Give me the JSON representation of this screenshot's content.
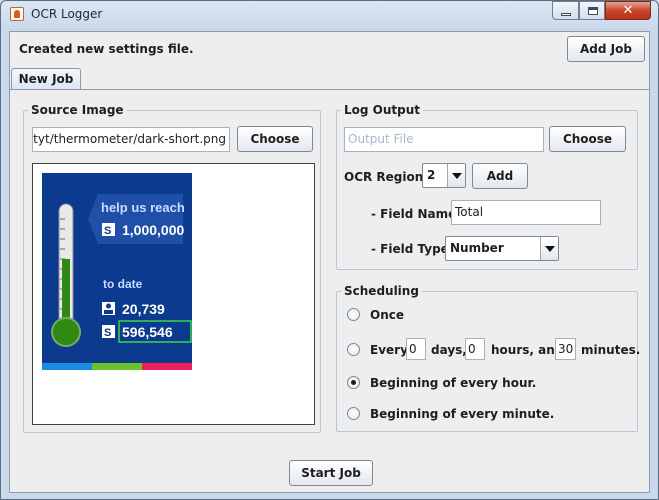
{
  "window": {
    "title": "OCR Logger"
  },
  "status": {
    "message": "Created new settings file."
  },
  "toolbar": {
    "add_job_label": "Add Job"
  },
  "tabs": [
    {
      "label": "New Job"
    }
  ],
  "source_image": {
    "legend": "Source Image",
    "path": "page/tyt/thermometer/dark-short.png",
    "choose_label": "Choose",
    "preview": {
      "headline": "help us reach",
      "goal_amount": "1,000,000",
      "subhead": "to date",
      "donor_count": "20,739",
      "raised_amount": "596,546",
      "dollar_glyph": "S",
      "colors": {
        "panel": "#0b3a8f",
        "mercury": "#2f8a14",
        "stripe_blue": "#1b8be0",
        "stripe_green": "#6cc12c",
        "stripe_red": "#ef1e5a"
      }
    }
  },
  "log_output": {
    "legend": "Log Output",
    "output_placeholder": "Output File",
    "choose_label": "Choose",
    "ocr_region_label": "OCR Region:",
    "ocr_region_value": "2",
    "add_label": "Add",
    "field_name_label": "- Field Name:",
    "field_name_value": "Total",
    "field_type_label": "- Field Type:",
    "field_type_value": "Number"
  },
  "scheduling": {
    "legend": "Scheduling",
    "once_label": "Once",
    "every_label": "Every",
    "days_value": "0",
    "days_label": "days,",
    "hours_value": "0",
    "hours_label": "hours, and",
    "minutes_value": "30",
    "minutes_label": "minutes.",
    "hour_label": "Beginning of every hour.",
    "minute_label": "Beginning of every minute.",
    "selected": "hour"
  },
  "footer": {
    "start_job_label": "Start Job"
  }
}
